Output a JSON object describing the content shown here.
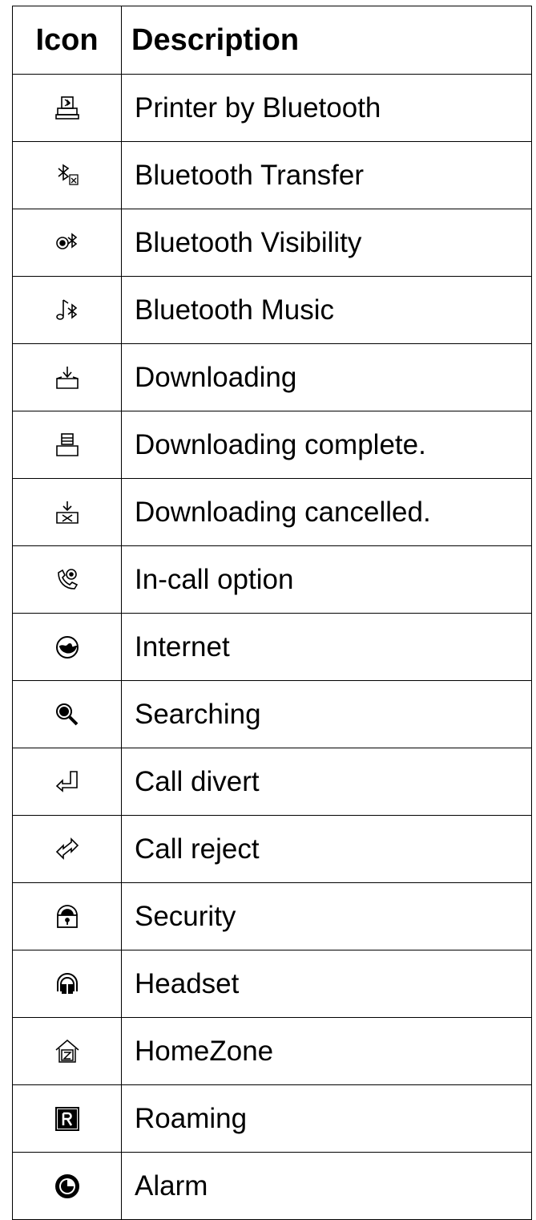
{
  "table": {
    "headers": {
      "icon": "Icon",
      "description": "Description"
    },
    "rows": [
      {
        "icon": "printer-bluetooth-icon",
        "description": "Printer by Bluetooth"
      },
      {
        "icon": "bluetooth-transfer-icon",
        "description": "Bluetooth Transfer"
      },
      {
        "icon": "bluetooth-visibility-icon",
        "description": "Bluetooth Visibility"
      },
      {
        "icon": "bluetooth-music-icon",
        "description": "Bluetooth Music"
      },
      {
        "icon": "downloading-icon",
        "description": "Downloading"
      },
      {
        "icon": "downloading-complete-icon",
        "description": "Downloading complete."
      },
      {
        "icon": "downloading-cancelled-icon",
        "description": "Downloading cancelled."
      },
      {
        "icon": "in-call-option-icon",
        "description": "In-call option"
      },
      {
        "icon": "internet-icon",
        "description": "Internet"
      },
      {
        "icon": "searching-icon",
        "description": "Searching"
      },
      {
        "icon": "call-divert-icon",
        "description": "Call divert"
      },
      {
        "icon": "call-reject-icon",
        "description": "Call reject"
      },
      {
        "icon": "security-icon",
        "description": "Security"
      },
      {
        "icon": "headset-icon",
        "description": "Headset"
      },
      {
        "icon": "homezone-icon",
        "description": "HomeZone"
      },
      {
        "icon": "roaming-icon",
        "description": "Roaming"
      },
      {
        "icon": "alarm-icon",
        "description": "Alarm"
      }
    ]
  }
}
